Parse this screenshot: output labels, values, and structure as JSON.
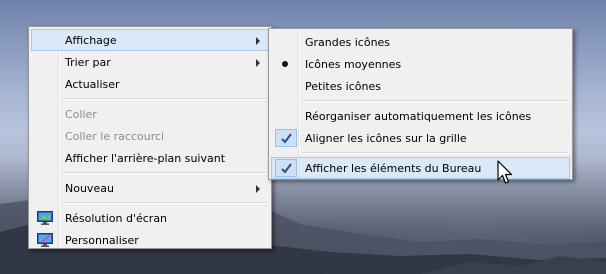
{
  "context_menu": {
    "items": [
      {
        "label": "Affichage"
      },
      {
        "label": "Trier par"
      },
      {
        "label": "Actualiser"
      },
      {
        "label": "Coller"
      },
      {
        "label": "Coller le raccourci"
      },
      {
        "label": "Afficher l'arrière-plan suivant"
      },
      {
        "label": "Nouveau"
      },
      {
        "label": "Résolution d'écran",
        "icon": "display-icon"
      },
      {
        "label": "Personnaliser",
        "icon": "personalize-icon"
      }
    ]
  },
  "submenu": {
    "items": [
      {
        "label": "Grandes icônes"
      },
      {
        "label": "Icônes moyennes",
        "selected": true
      },
      {
        "label": "Petites icônes"
      },
      {
        "label": "Réorganiser automatiquement les icônes"
      },
      {
        "label": "Aligner les icônes sur la grille",
        "checked": true
      },
      {
        "label": "Afficher les éléments du Bureau",
        "checked": true
      }
    ]
  },
  "colors": {
    "highlight": "#dbe8f8",
    "menu_bg": "#f0f0f0",
    "disabled_text": "#8d8d8d"
  }
}
